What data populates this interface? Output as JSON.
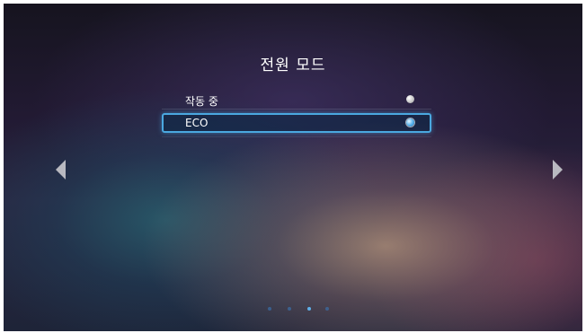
{
  "title": "전원 모드",
  "options": [
    {
      "label": "작동 중",
      "selected": false
    },
    {
      "label": "ECO",
      "selected": true
    }
  ],
  "navigation": {
    "left_icon": "triangle-left",
    "right_icon": "triangle-right"
  },
  "pager": {
    "total": 4,
    "active_index": 2
  },
  "colors": {
    "accent": "#4aa8e0",
    "text": "#ffffff"
  }
}
